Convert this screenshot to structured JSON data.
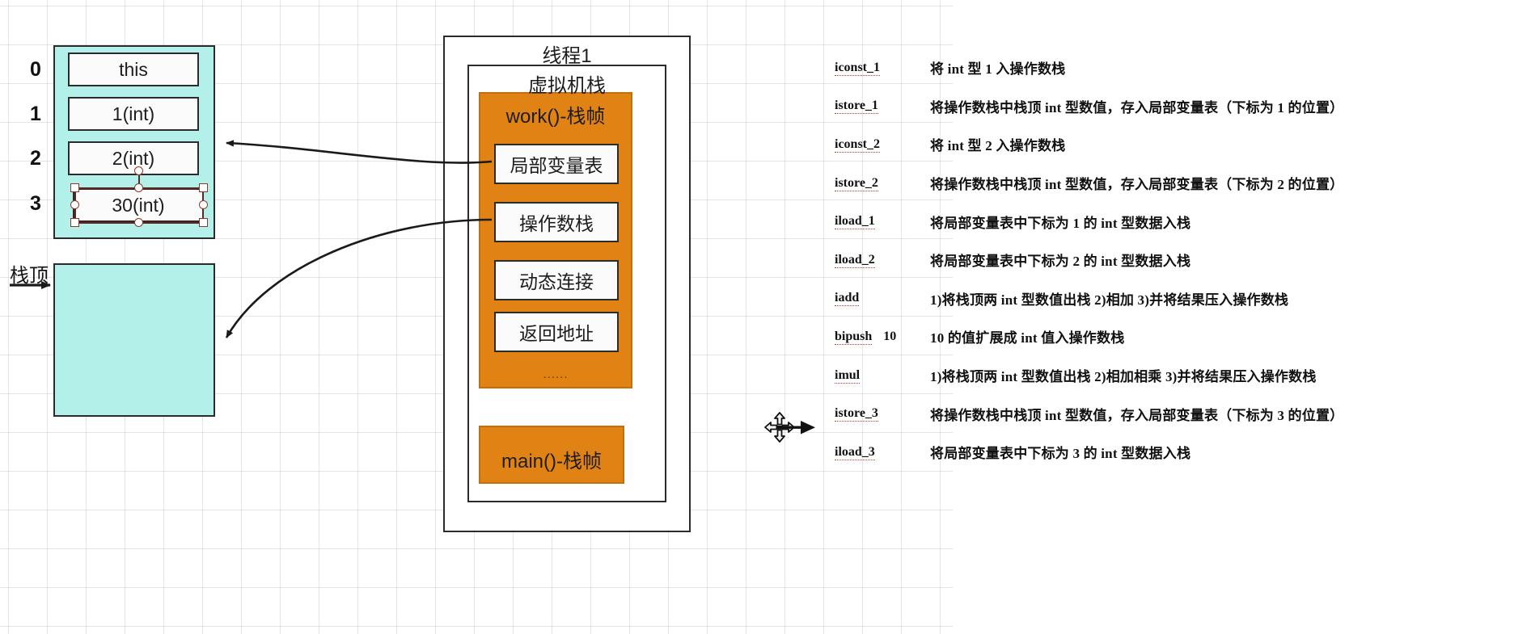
{
  "local_variable_table": {
    "indices": [
      "0",
      "1",
      "2",
      "3"
    ],
    "slots": [
      {
        "label": "this",
        "selected": false
      },
      {
        "label": "1(int)",
        "selected": false
      },
      {
        "label": "2(int)",
        "selected": false
      },
      {
        "label": "30(int)",
        "selected": true
      }
    ]
  },
  "operand_stack": {
    "stack_top_label": "栈顶",
    "content": ""
  },
  "thread": {
    "title": "线程1",
    "vm_stack_title": "虚拟机栈",
    "current_frame": {
      "title": "work()-栈帧",
      "items": [
        "局部变量表",
        "操作数栈",
        "动态连接",
        "返回地址"
      ],
      "ellipsis": "......"
    },
    "lower_frame": {
      "title": "main()-栈帧"
    }
  },
  "instructions": {
    "rows": [
      {
        "mnemonic": "iconst_1",
        "operand": "",
        "description": "将 int 型 1 入操作数栈"
      },
      {
        "mnemonic": "istore_1",
        "operand": "",
        "description": "将操作数栈中栈顶 int 型数值，存入局部变量表（下标为 1 的位置）"
      },
      {
        "mnemonic": "iconst_2",
        "operand": "",
        "description": "将 int 型 2 入操作数栈"
      },
      {
        "mnemonic": "istore_2",
        "operand": "",
        "description": "将操作数栈中栈顶 int 型数值，存入局部变量表（下标为 2 的位置）"
      },
      {
        "mnemonic": "iload_1",
        "operand": "",
        "description": "将局部变量表中下标为 1 的 int 型数据入栈"
      },
      {
        "mnemonic": "iload_2",
        "operand": "",
        "description": "将局部变量表中下标为 2 的 int 型数据入栈"
      },
      {
        "mnemonic": "iadd",
        "operand": "",
        "description": "1)将栈顶两 int 型数值出栈  2)相加  3)并将结果压入操作数栈"
      },
      {
        "mnemonic": "bipush",
        "operand": "10",
        "description": "10 的值扩展成 int 值入操作数栈"
      },
      {
        "mnemonic": "imul",
        "operand": "",
        "description": "1)将栈顶两 int 型数值出栈  2)相加相乘 3)并将结果压入操作数栈"
      },
      {
        "mnemonic": "istore_3",
        "operand": "",
        "description": "将操作数栈中栈顶 int 型数值，存入局部变量表（下标为 3 的位置）"
      },
      {
        "mnemonic": "iload_3",
        "operand": "",
        "description": "将局部变量表中下标为 3 的 int 型数据入栈"
      }
    ]
  },
  "cursor": {
    "type": "move-cursor"
  },
  "colors": {
    "cyan_fill": "#b3f0ea",
    "orange_fill": "#e08214",
    "box_border": "#2b2b2b",
    "selection": "#8b3a2d"
  }
}
